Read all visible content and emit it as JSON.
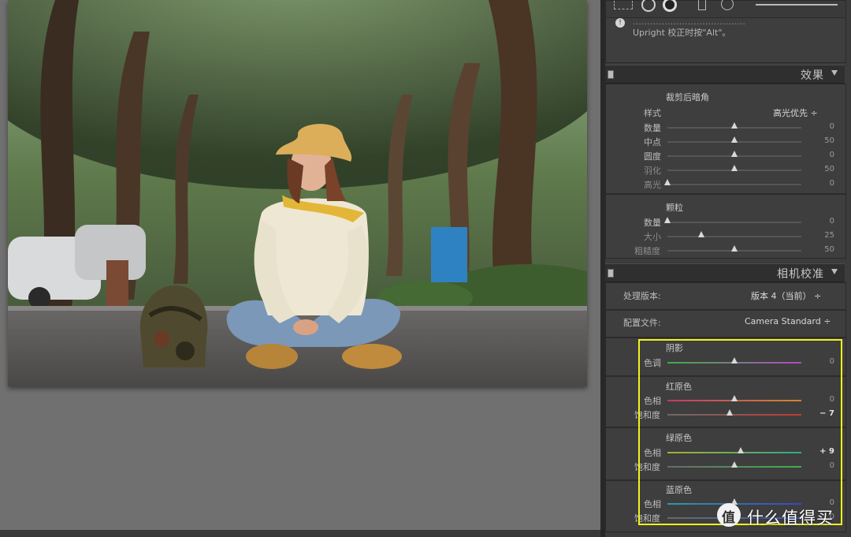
{
  "top_panel": {
    "note_line1": "…………………………………",
    "note_line2": "Upright 校正时按\"Alt\"。"
  },
  "effects": {
    "title": "效果",
    "vignette": {
      "title": "裁剪后暗角",
      "style_label": "样式",
      "style_value": "高光优先 ÷",
      "sliders": [
        {
          "label": "数量",
          "value": "0",
          "pos": 0.5
        },
        {
          "label": "中点",
          "value": "50",
          "pos": 0.5
        },
        {
          "label": "圆度",
          "value": "0",
          "pos": 0.5
        },
        {
          "label": "羽化",
          "value": "50",
          "pos": 0.5
        },
        {
          "label": "高光",
          "value": "0",
          "pos": 0.0
        }
      ]
    },
    "grain": {
      "title": "颗粒",
      "sliders": [
        {
          "label": "数量",
          "value": "0",
          "pos": 0.0
        },
        {
          "label": "大小",
          "value": "25",
          "pos": 0.25
        },
        {
          "label": "粗糙度",
          "value": "50",
          "pos": 0.5
        }
      ]
    }
  },
  "calibration": {
    "title": "相机校准",
    "process_label": "处理版本:",
    "process_value": "版本 4（当前） ÷",
    "profile_label": "配置文件:",
    "profile_value": "Camera Standard ÷",
    "shadows": {
      "title": "阴影",
      "tint_label": "色调",
      "tint_value": "0",
      "tint_pos": 0.5
    },
    "red": {
      "title": "红原色",
      "hue_label": "色相",
      "hue_value": "0",
      "hue_pos": 0.5,
      "sat_label": "饱和度",
      "sat_value": "− 7",
      "sat_pos": 0.465
    },
    "green": {
      "title": "绿原色",
      "hue_label": "色相",
      "hue_value": "+ 9",
      "hue_pos": 0.545,
      "sat_label": "饱和度",
      "sat_value": "0",
      "sat_pos": 0.5
    },
    "blue": {
      "title": "蓝原色",
      "hue_label": "色相",
      "hue_value": "0",
      "hue_pos": 0.5,
      "sat_label": "饱和度",
      "sat_value": "0",
      "sat_pos": 0.5
    }
  },
  "watermark": {
    "text": "什么值得买",
    "logo_char": "值"
  },
  "colors": {
    "highlight": "#f2f21a",
    "panel_bg": "#3e3e3e",
    "stage_bg": "#707070"
  }
}
